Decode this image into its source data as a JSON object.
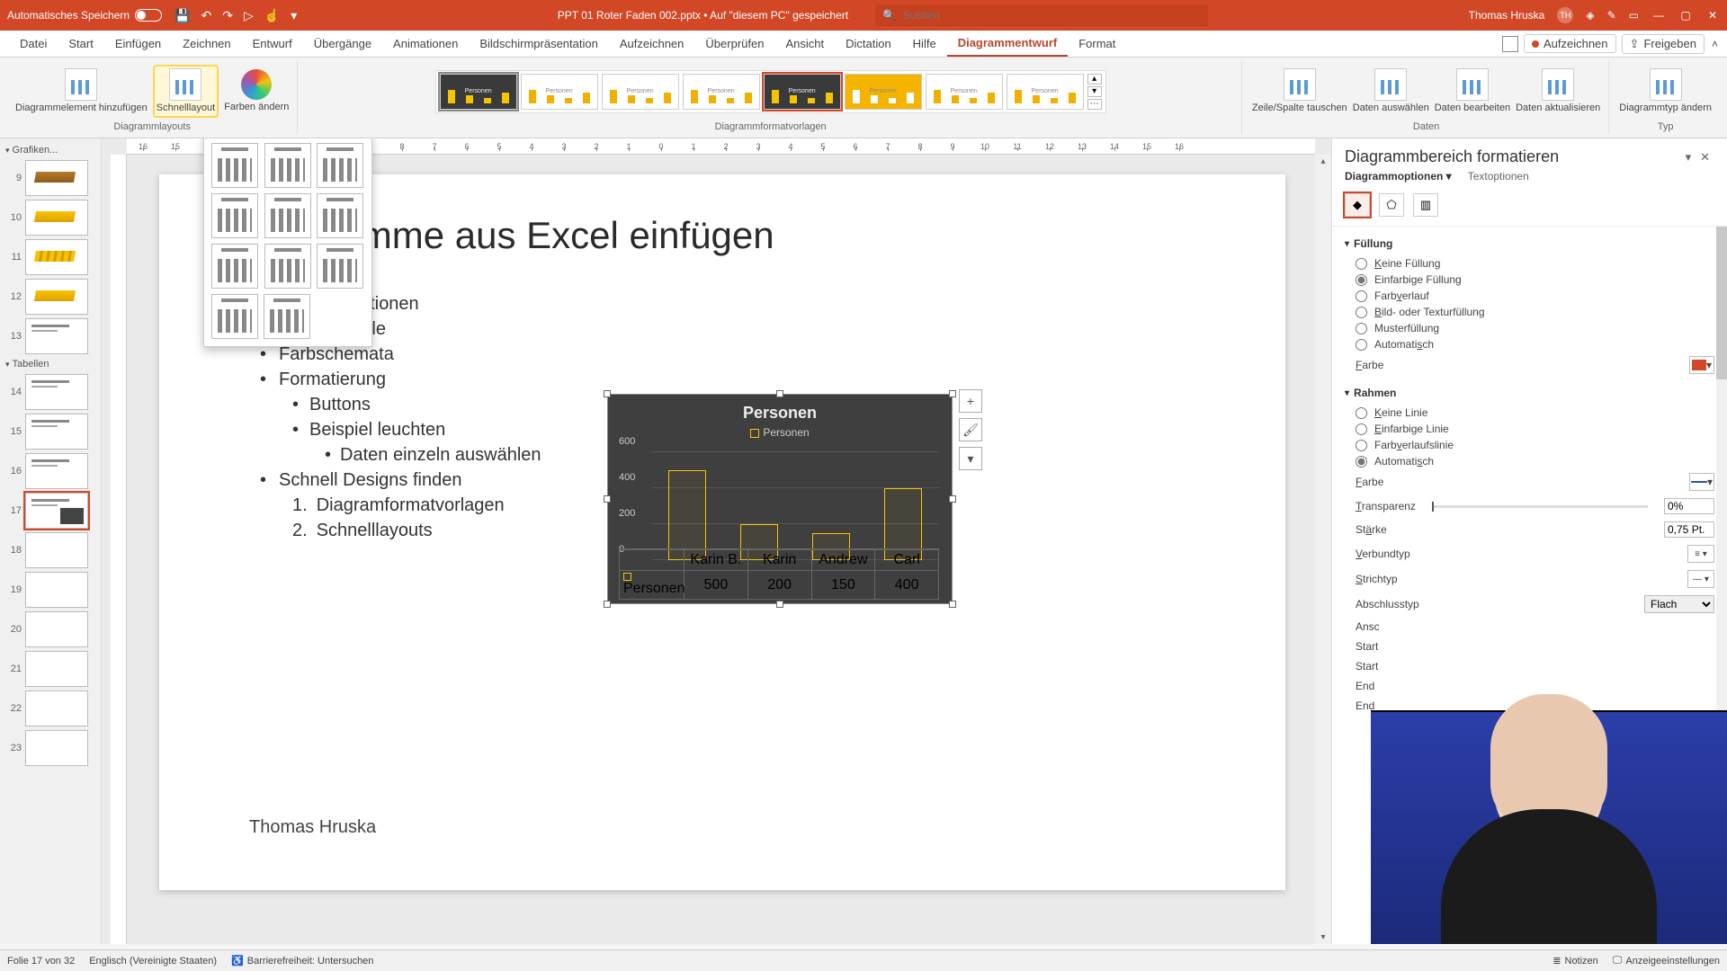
{
  "titlebar": {
    "autosave_label": "Automatisches Speichern",
    "doc_title": "PPT 01 Roter Faden 002.pptx • Auf \"diesem PC\" gespeichert",
    "search_placeholder": "Suchen",
    "user_name": "Thomas Hruska",
    "user_initials": "TH"
  },
  "tabs": {
    "items": [
      "Datei",
      "Start",
      "Einfügen",
      "Zeichnen",
      "Entwurf",
      "Übergänge",
      "Animationen",
      "Bildschirmpräsentation",
      "Aufzeichnen",
      "Überprüfen",
      "Ansicht",
      "Dictation",
      "Hilfe",
      "Diagrammentwurf",
      "Format"
    ],
    "record_label": "Aufzeichnen",
    "share_label": "Freigeben"
  },
  "ribbon": {
    "add_element": "Diagrammelement hinzufügen",
    "quick_layout": "Schnelllayout",
    "change_colors": "Farben ändern",
    "group_layouts": "Diagrammlayouts",
    "group_styles": "Diagrammformatvorlagen",
    "style_thumb_title": "Personen",
    "swap": "Zeile/Spalte tauschen",
    "select_data": "Daten auswählen",
    "edit_data": "Daten bearbeiten",
    "refresh_data": "Daten aktualisieren",
    "group_data": "Daten",
    "change_type": "Diagrammtyp ändern",
    "group_type": "Typ"
  },
  "ruler_ticks": [
    "16",
    "15",
    "14",
    "13",
    "12",
    "11",
    "10",
    "9",
    "8",
    "7",
    "6",
    "5",
    "4",
    "3",
    "2",
    "1",
    "0",
    "1",
    "2",
    "3",
    "4",
    "5",
    "6",
    "7",
    "8",
    "9",
    "10",
    "11",
    "12",
    "13",
    "14",
    "15",
    "16"
  ],
  "thumbnails": {
    "section_graphics": "Grafiken...",
    "section_tables": "Tabellen",
    "start_index": 9,
    "active": 17,
    "count": 15
  },
  "slide": {
    "title": "Diagramme aus Excel einfügen",
    "bullets": {
      "b1": "Einfüge-Optionen",
      "b2": "Vor/Nachteile",
      "b3": "Farbschemata",
      "b4": "Formatierung",
      "b4a": "Buttons",
      "b4b": "Beispiel leuchten",
      "b4b1": "Daten einzeln auswählen",
      "b5": "Schnell Designs finden",
      "b5_1": "Diagramformatvorlagen",
      "b5_2": "Schnelllayouts"
    },
    "footer": "Thomas Hruska"
  },
  "chart_data": {
    "type": "bar",
    "title": "Personen",
    "legend": "Personen",
    "xlabel": "",
    "ylabel": "",
    "ylim": [
      0,
      600
    ],
    "yticks": [
      0,
      200,
      400,
      600
    ],
    "categories": [
      "Karin B.",
      "Karin",
      "Andrew",
      "Carl"
    ],
    "series": [
      {
        "name": "Personen",
        "values": [
          500,
          200,
          150,
          400
        ]
      }
    ]
  },
  "chart_side": {
    "plus": "+",
    "brush": "🖌",
    "filter": "▾"
  },
  "format_pane": {
    "title": "Diagrammbereich formatieren",
    "tab_options": "Diagrammoptionen",
    "tab_text": "Textoptionen",
    "sec_fill": "Füllung",
    "fill_none": "Keine Füllung",
    "fill_solid": "Einfarbige Füllung",
    "fill_gradient": "Farbverlauf",
    "fill_picture": "Bild- oder Texturfüllung",
    "fill_pattern": "Musterfüllung",
    "fill_auto": "Automatisch",
    "color_label": "Farbe",
    "sec_border": "Rahmen",
    "line_none": "Keine Linie",
    "line_solid": "Einfarbige Linie",
    "line_gradient": "Farbverlaufslinie",
    "line_auto": "Automatisch",
    "transparency": "Transparenz",
    "transparency_val": "0%",
    "width_label": "Stärke",
    "width_val": "0,75 Pt.",
    "compound": "Verbundtyp",
    "dash": "Strichtyp",
    "cap": "Abschlusstyp",
    "cap_val": "Flach",
    "join_prefix": "Ansc",
    "arrow_begin_type_prefix": "Start",
    "arrow_begin_size_prefix": "Start",
    "arrow_end_type_prefix": "End",
    "arrow_end_size_prefix": "End"
  },
  "statusbar": {
    "slide_of": "Folie 17 von 32",
    "language": "Englisch (Vereinigte Staaten)",
    "accessibility": "Barrierefreiheit: Untersuchen",
    "notes": "Notizen",
    "display": "Anzeigeeinstellungen"
  }
}
